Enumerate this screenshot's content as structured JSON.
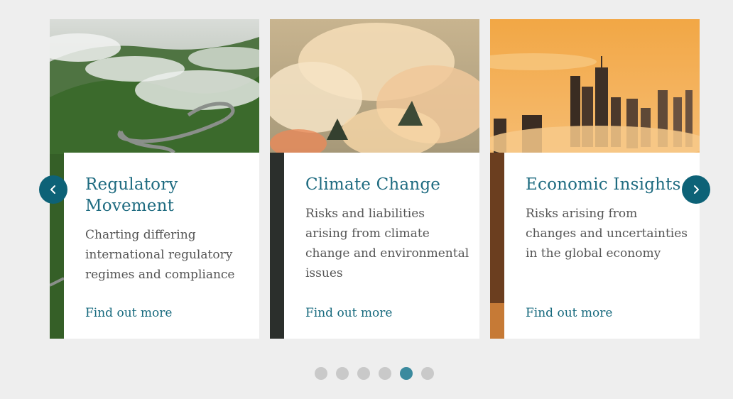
{
  "cards": [
    {
      "title": "Regulatory Movement",
      "description": "Charting differing international regulatory regimes and compliance",
      "link": "Find out more",
      "image_subject": "misty forest with winding road"
    },
    {
      "title": "Climate Change",
      "description": "Risks and liabilities arising from climate change and environmental issues",
      "link": "Find out more",
      "image_subject": "wildfire smoke over forest"
    },
    {
      "title": "Economic Insights",
      "description": "Risks arising from changes and uncertainties in the global economy",
      "link": "Find out more",
      "image_subject": "city skyscrapers above orange clouds"
    }
  ],
  "navigation": {
    "prev_icon": "chevron-left-icon",
    "next_icon": "chevron-right-icon"
  },
  "pagination": {
    "total": 6,
    "active_index": 4
  },
  "colors": {
    "background": "#eeeeee",
    "accent": "#0d6277",
    "title": "#1e6b80",
    "link": "#16697d",
    "body_text": "#555555",
    "dot_inactive": "#c9c9c9",
    "dot_active": "#3b8a9e"
  }
}
